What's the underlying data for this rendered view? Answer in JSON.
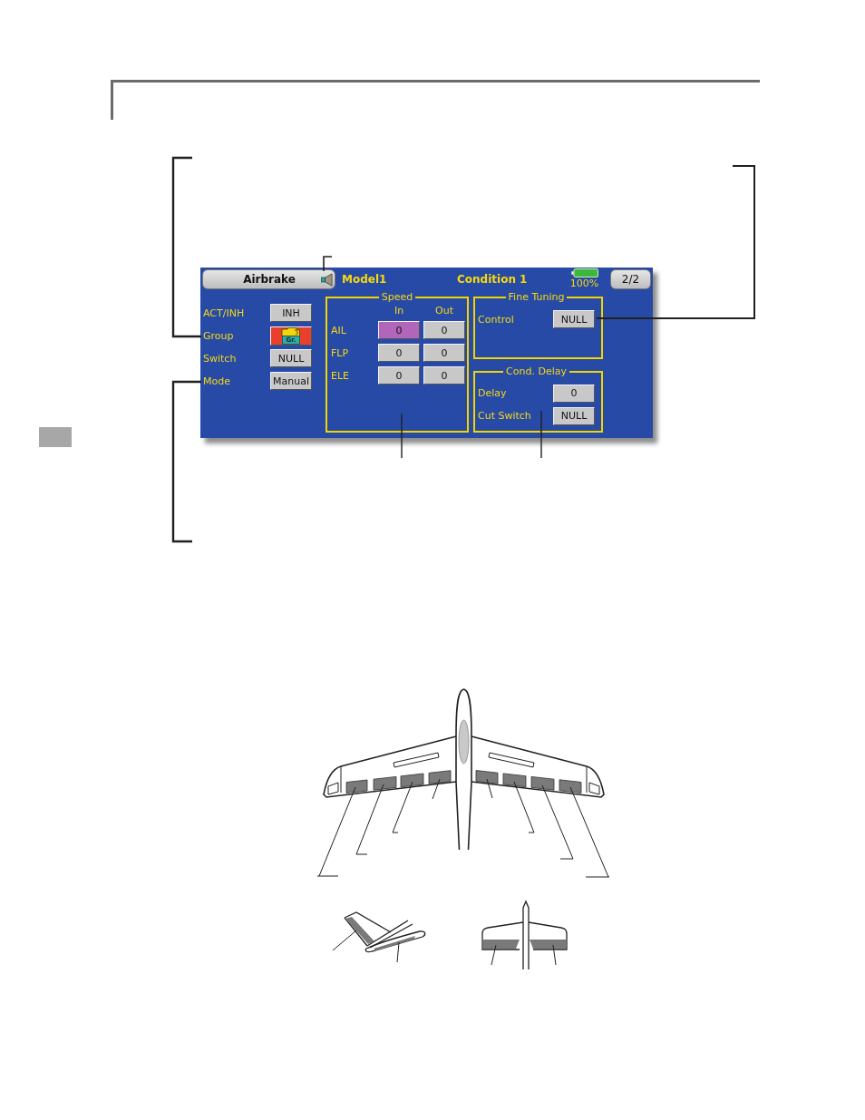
{
  "screen": {
    "title_tab": {
      "label": "Airbrake"
    },
    "model": "Model1",
    "condition": "Condition 1",
    "battery": {
      "reading": "100%"
    },
    "page_button": "2/2",
    "settings": [
      {
        "label": "ACT/INH",
        "kind": "value",
        "value": "INH"
      },
      {
        "label": "Group",
        "kind": "group",
        "tag": "Gr."
      },
      {
        "label": "Switch",
        "kind": "value",
        "value": "NULL"
      },
      {
        "label": "Mode",
        "kind": "value",
        "value": "Manual"
      }
    ],
    "speed": {
      "title": "Speed",
      "columns": [
        "In",
        "Out"
      ],
      "rows": [
        {
          "label": "AIL",
          "cells": [
            {
              "value": "0",
              "selected": true
            },
            {
              "value": "0",
              "selected": false
            }
          ]
        },
        {
          "label": "FLP",
          "cells": [
            {
              "value": "0",
              "selected": false
            },
            {
              "value": "0",
              "selected": false
            }
          ]
        },
        {
          "label": "ELE",
          "cells": [
            {
              "value": "0",
              "selected": false
            },
            {
              "value": "0",
              "selected": false
            }
          ]
        }
      ]
    },
    "fine_tuning": {
      "title": "Fine Tuning",
      "rows": [
        {
          "label": "Control",
          "value": "NULL"
        }
      ]
    },
    "cond_delay": {
      "title": "Cond. Delay",
      "rows": [
        {
          "label": "Delay",
          "value": "0"
        },
        {
          "label": "Cut Switch",
          "value": "NULL"
        }
      ]
    }
  }
}
